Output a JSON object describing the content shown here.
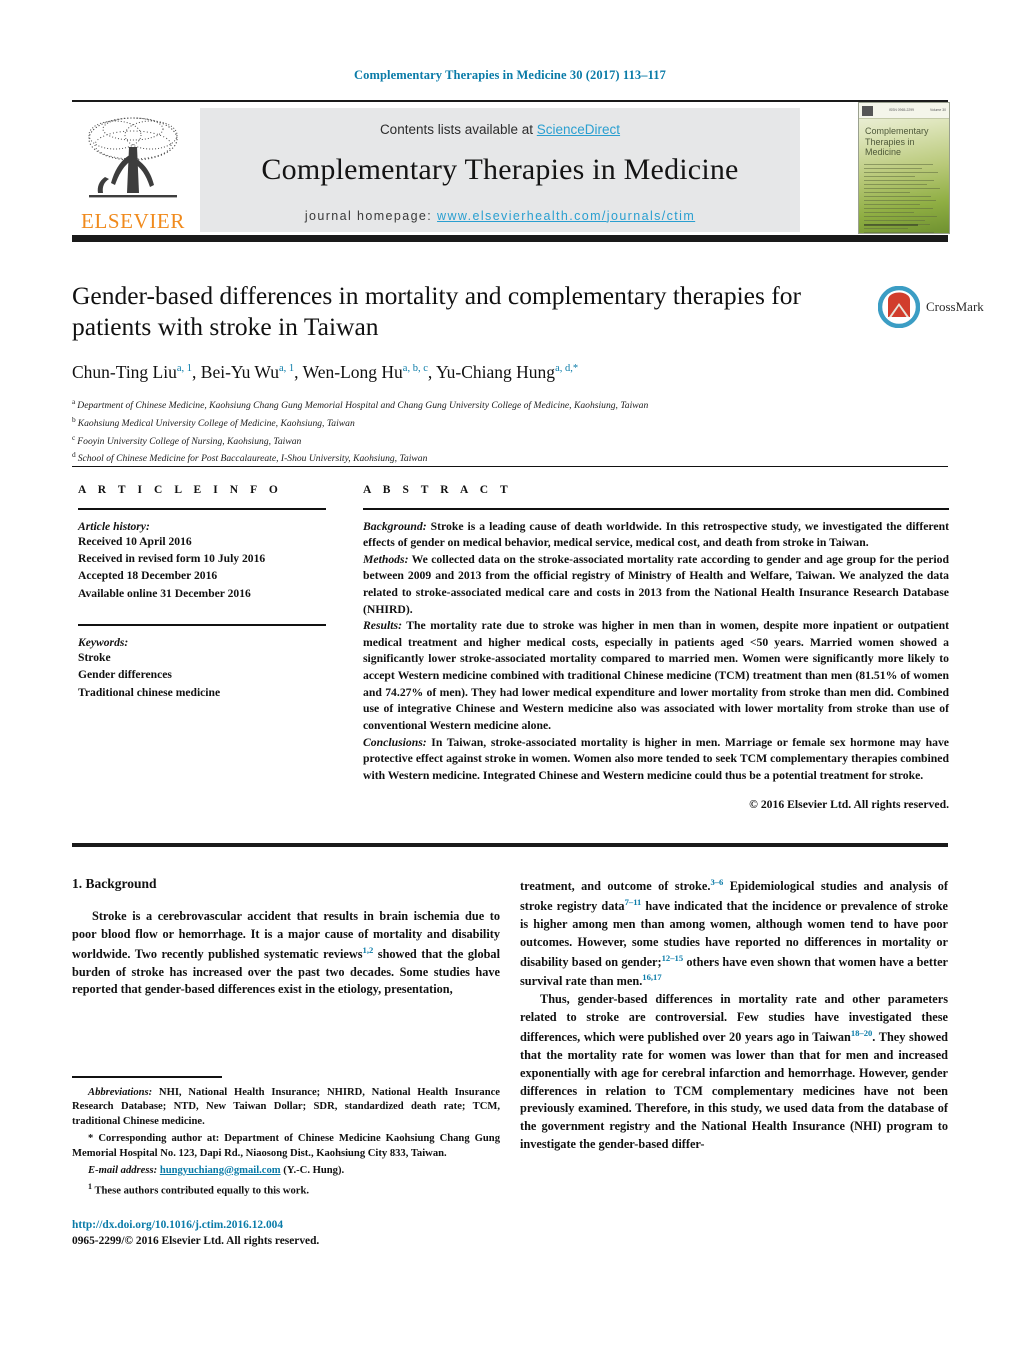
{
  "running_head": "Complementary Therapies in Medicine 30 (2017) 113–117",
  "masthead": {
    "contents_prefix": "Contents lists available at ",
    "sciencedirect": "ScienceDirect",
    "journal_title": "Complementary Therapies in Medicine",
    "homepage_label": "journal homepage: ",
    "homepage_url": "www.elsevierhealth.com/journals/ctim",
    "publisher": "ELSEVIER",
    "cover_title_lines": [
      "Complementary",
      "Therapies in",
      "Medicine"
    ],
    "band_color": "#e6e7e8",
    "link_color": "#2a9fd0",
    "elsevier_orange": "#f08a1c"
  },
  "article": {
    "title": "Gender-based differences in mortality and complementary therapies for patients with stroke in Taiwan",
    "authors_html": "Chun-Ting Liu<sup>a, 1</sup>, Bei-Yu Wu<sup>a, 1</sup>, Wen-Long Hu<sup>a, b, c</sup>, Yu-Chiang Hung<sup>a, d,</sup><sup class=\"star\">*</sup>",
    "affiliations": [
      {
        "mark": "a",
        "text": "Department of Chinese Medicine, Kaohsiung Chang Gung Memorial Hospital and Chang Gung University College of Medicine, Kaohsiung, Taiwan"
      },
      {
        "mark": "b",
        "text": "Kaohsiung Medical University College of Medicine, Kaohsiung, Taiwan"
      },
      {
        "mark": "c",
        "text": "Fooyin University College of Nursing, Kaohsiung, Taiwan"
      },
      {
        "mark": "d",
        "text": "School of Chinese Medicine for Post Baccalaureate, I-Shou University, Kaohsiung, Taiwan"
      }
    ],
    "crossmark_label": "CrossMark"
  },
  "article_info": {
    "heading": "A R T I C L E   I N F O",
    "history_label": "Article history:",
    "history": [
      "Received 10 April 2016",
      "Received in revised form 10 July 2016",
      "Accepted 18 December 2016",
      "Available online 31 December 2016"
    ],
    "keywords_label": "Keywords:",
    "keywords": [
      "Stroke",
      "Gender differences",
      "Traditional chinese medicine"
    ]
  },
  "abstract": {
    "heading": "A B S T R A C T",
    "background_label": "Background:",
    "background": " Stroke is a leading cause of death worldwide. In this retrospective study, we investigated the different effects of gender on medical behavior, medical service, medical cost, and death from stroke in Taiwan.",
    "methods_label": "Methods:",
    "methods": " We collected data on the stroke-associated mortality rate according to gender and age group for the period between 2009 and 2013 from the official registry of Ministry of Health and Welfare, Taiwan. We analyzed the data related to stroke-associated medical care and costs in 2013 from the National Health Insurance Research Database (NHIRD).",
    "results_label": "Results:",
    "results": " The mortality rate due to stroke was higher in men than in women, despite more inpatient or outpatient medical treatment and higher medical costs, especially in patients aged <50 years. Married women showed a significantly lower stroke-associated mortality compared to married men. Women were significantly more likely to accept Western medicine combined with traditional Chinese medicine (TCM) treatment than men (81.51% of women and 74.27% of men). They had lower medical expenditure and lower mortality from stroke than men did. Combined use of integrative Chinese and Western medicine also was associated with lower mortality from stroke than use of conventional Western medicine alone.",
    "conclusions_label": "Conclusions:",
    "conclusions": " In Taiwan, stroke-associated mortality is higher in men. Marriage or female sex hormone may have protective effect against stroke in women. Women also more tended to seek TCM complementary therapies combined with Western medicine. Integrated Chinese and Western medicine could thus be a potential treatment for stroke.",
    "copyright": "© 2016 Elsevier Ltd. All rights reserved."
  },
  "body": {
    "section_heading": "1. Background",
    "left_paragraph_html": "Stroke is a cerebrovascular accident that results in brain ischemia due to poor blood flow or hemorrhage. It is a major cause of mortality and disability worldwide. Two recently published systematic reviews<sup>1,2</sup> showed that the global burden of stroke has increased over the past two decades. Some studies have reported that gender-based differences exist in the etiology, presentation,",
    "right_paragraph_1_html": "treatment, and outcome of stroke.<sup>3–6</sup> Epidemiological studies and analysis of stroke registry data<sup>7–11</sup> have indicated that the incidence or prevalence of stroke is higher among men than among women, although women tend to have poor outcomes. However, some studies have reported no differences in mortality or disability based on gender;<sup>12–15</sup> others have even shown that women have a better survival rate than men.<sup>16,17</sup>",
    "right_paragraph_2_html": "Thus, gender-based differences in mortality rate and other parameters related to stroke are controversial. Few studies have investigated these differences, which were published over 20 years ago in Taiwan<sup>18–20</sup>. They showed that the mortality rate for women was lower than that for men and increased exponentially with age for cerebral infarction and hemorrhage. However, gender differences in relation to TCM complementary medicines have not been previously examined. Therefore, in this study, we used data from the database of the government registry and the National Health Insurance (NHI) program to investigate the gender-based differ-"
  },
  "footnotes": {
    "abbreviations_label": "Abbreviations:",
    "abbreviations": " NHI, National Health Insurance; NHIRD, National Health Insurance Research Database; NTD, New Taiwan Dollar; SDR, standardized death rate; TCM, traditional Chinese medicine.",
    "corresponding_mark": "*",
    "corresponding": " Corresponding author at: Department of Chinese Medicine Kaohsiung Chang Gung Memorial Hospital No. 123, Dapi Rd., Niaosong Dist., Kaohsiung City 833, Taiwan.",
    "email_label": "E-mail address:",
    "email": "hungyuchiang@gmail.com",
    "email_owner": " (Y.-C. Hung).",
    "equal_contrib_mark": "1",
    "equal_contrib": " These authors contributed equally to this work.",
    "doi": "http://dx.doi.org/10.1016/j.ctim.2016.12.004",
    "issn_line": "0965-2299/© 2016 Elsevier Ltd. All rights reserved."
  }
}
